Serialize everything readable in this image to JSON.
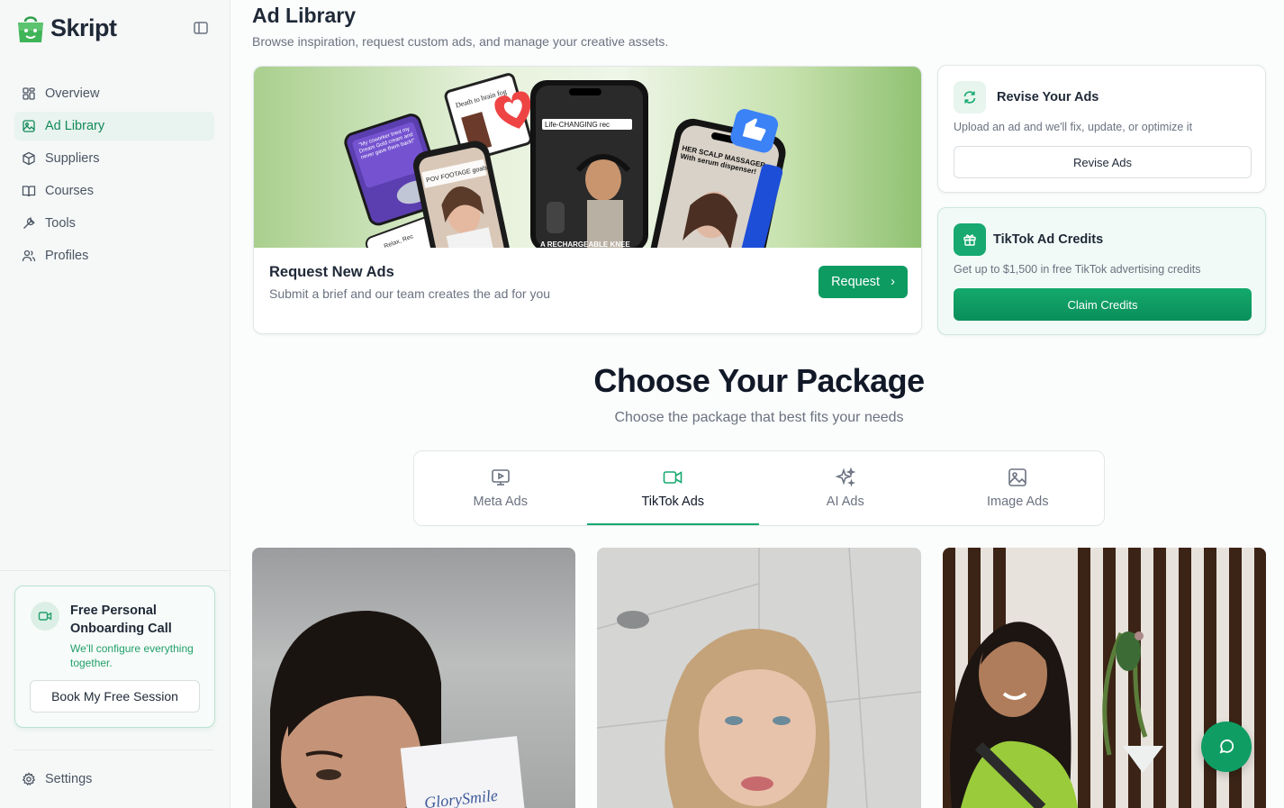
{
  "brand": {
    "name": "Skript"
  },
  "sidebar": {
    "items": [
      {
        "label": "Overview",
        "icon": "grid-icon",
        "active": false
      },
      {
        "label": "Ad Library",
        "icon": "image-icon",
        "active": true
      },
      {
        "label": "Suppliers",
        "icon": "package-icon",
        "active": false
      },
      {
        "label": "Courses",
        "icon": "book-open-icon",
        "active": false
      },
      {
        "label": "Tools",
        "icon": "wrench-icon",
        "active": false
      },
      {
        "label": "Profiles",
        "icon": "users-icon",
        "active": false
      }
    ],
    "onboarding": {
      "title": "Free Personal Onboarding Call",
      "subtitle": "We'll configure everything together.",
      "button": "Book My Free Session"
    },
    "settings": "Settings"
  },
  "header": {
    "title": "Ad Library",
    "subtitle": "Browse inspiration, request custom ads, and manage your creative assets."
  },
  "hero": {
    "image_texts": {
      "ad_brain": "Death to brain fog",
      "ad_review": "\"My coworker tried my Dream Gold cream and never gave them back!\"",
      "ad_pov": "POV FOOTAGE goals",
      "ad_life": "Life-CHANGING rec",
      "ad_scalp": "HER SCALP MASSAGER With serum dispenser!",
      "ad_bottom": "A RECHARGEABLE KNEE",
      "ad_relax": "Relax, Rec"
    },
    "title": "Request New Ads",
    "subtitle": "Submit a brief and our team creates the ad for you",
    "button": "Request",
    "button_arrow": "›"
  },
  "revise": {
    "title": "Revise Your Ads",
    "subtitle": "Upload an ad and we'll fix, update, or optimize it",
    "button": "Revise Ads"
  },
  "tiktok_credits": {
    "title": "TikTok Ad Credits",
    "subtitle": "Get up to $1,500 in free TikTok advertising credits",
    "button": "Claim Credits"
  },
  "packages": {
    "title": "Choose Your Package",
    "subtitle": "Choose the package that best fits your needs",
    "tabs": [
      {
        "label": "Meta Ads",
        "icon": "monitor-play-icon",
        "active": false
      },
      {
        "label": "TikTok Ads",
        "icon": "video-icon",
        "active": true
      },
      {
        "label": "AI Ads",
        "icon": "sparkles-icon",
        "active": false
      },
      {
        "label": "Image Ads",
        "icon": "image-icon",
        "active": false
      }
    ]
  },
  "videos": {
    "card1_product": "GlorySmile"
  },
  "colors": {
    "accent": "#0d9b62",
    "accent_light": "#e9f3ef",
    "sidebar_bg": "#f5f8f7"
  }
}
